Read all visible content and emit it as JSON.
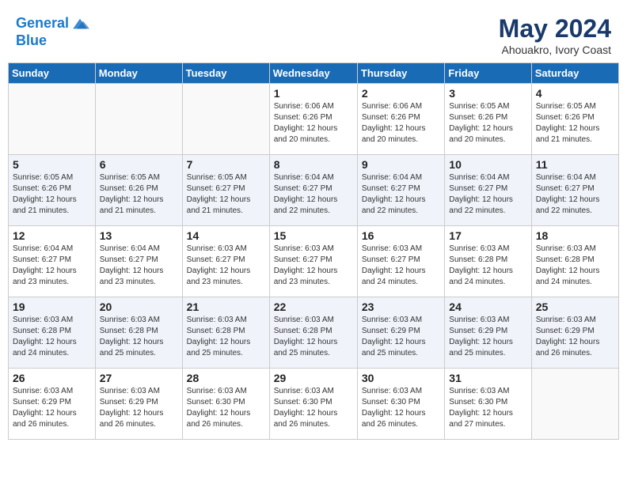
{
  "header": {
    "logo_line1": "General",
    "logo_line2": "Blue",
    "month_year": "May 2024",
    "location": "Ahouakro, Ivory Coast"
  },
  "weekdays": [
    "Sunday",
    "Monday",
    "Tuesday",
    "Wednesday",
    "Thursday",
    "Friday",
    "Saturday"
  ],
  "weeks": [
    [
      {
        "day": "",
        "info": ""
      },
      {
        "day": "",
        "info": ""
      },
      {
        "day": "",
        "info": ""
      },
      {
        "day": "1",
        "info": "Sunrise: 6:06 AM\nSunset: 6:26 PM\nDaylight: 12 hours\nand 20 minutes."
      },
      {
        "day": "2",
        "info": "Sunrise: 6:06 AM\nSunset: 6:26 PM\nDaylight: 12 hours\nand 20 minutes."
      },
      {
        "day": "3",
        "info": "Sunrise: 6:05 AM\nSunset: 6:26 PM\nDaylight: 12 hours\nand 20 minutes."
      },
      {
        "day": "4",
        "info": "Sunrise: 6:05 AM\nSunset: 6:26 PM\nDaylight: 12 hours\nand 21 minutes."
      }
    ],
    [
      {
        "day": "5",
        "info": "Sunrise: 6:05 AM\nSunset: 6:26 PM\nDaylight: 12 hours\nand 21 minutes."
      },
      {
        "day": "6",
        "info": "Sunrise: 6:05 AM\nSunset: 6:26 PM\nDaylight: 12 hours\nand 21 minutes."
      },
      {
        "day": "7",
        "info": "Sunrise: 6:05 AM\nSunset: 6:27 PM\nDaylight: 12 hours\nand 21 minutes."
      },
      {
        "day": "8",
        "info": "Sunrise: 6:04 AM\nSunset: 6:27 PM\nDaylight: 12 hours\nand 22 minutes."
      },
      {
        "day": "9",
        "info": "Sunrise: 6:04 AM\nSunset: 6:27 PM\nDaylight: 12 hours\nand 22 minutes."
      },
      {
        "day": "10",
        "info": "Sunrise: 6:04 AM\nSunset: 6:27 PM\nDaylight: 12 hours\nand 22 minutes."
      },
      {
        "day": "11",
        "info": "Sunrise: 6:04 AM\nSunset: 6:27 PM\nDaylight: 12 hours\nand 22 minutes."
      }
    ],
    [
      {
        "day": "12",
        "info": "Sunrise: 6:04 AM\nSunset: 6:27 PM\nDaylight: 12 hours\nand 23 minutes."
      },
      {
        "day": "13",
        "info": "Sunrise: 6:04 AM\nSunset: 6:27 PM\nDaylight: 12 hours\nand 23 minutes."
      },
      {
        "day": "14",
        "info": "Sunrise: 6:03 AM\nSunset: 6:27 PM\nDaylight: 12 hours\nand 23 minutes."
      },
      {
        "day": "15",
        "info": "Sunrise: 6:03 AM\nSunset: 6:27 PM\nDaylight: 12 hours\nand 23 minutes."
      },
      {
        "day": "16",
        "info": "Sunrise: 6:03 AM\nSunset: 6:27 PM\nDaylight: 12 hours\nand 24 minutes."
      },
      {
        "day": "17",
        "info": "Sunrise: 6:03 AM\nSunset: 6:28 PM\nDaylight: 12 hours\nand 24 minutes."
      },
      {
        "day": "18",
        "info": "Sunrise: 6:03 AM\nSunset: 6:28 PM\nDaylight: 12 hours\nand 24 minutes."
      }
    ],
    [
      {
        "day": "19",
        "info": "Sunrise: 6:03 AM\nSunset: 6:28 PM\nDaylight: 12 hours\nand 24 minutes."
      },
      {
        "day": "20",
        "info": "Sunrise: 6:03 AM\nSunset: 6:28 PM\nDaylight: 12 hours\nand 25 minutes."
      },
      {
        "day": "21",
        "info": "Sunrise: 6:03 AM\nSunset: 6:28 PM\nDaylight: 12 hours\nand 25 minutes."
      },
      {
        "day": "22",
        "info": "Sunrise: 6:03 AM\nSunset: 6:28 PM\nDaylight: 12 hours\nand 25 minutes."
      },
      {
        "day": "23",
        "info": "Sunrise: 6:03 AM\nSunset: 6:29 PM\nDaylight: 12 hours\nand 25 minutes."
      },
      {
        "day": "24",
        "info": "Sunrise: 6:03 AM\nSunset: 6:29 PM\nDaylight: 12 hours\nand 25 minutes."
      },
      {
        "day": "25",
        "info": "Sunrise: 6:03 AM\nSunset: 6:29 PM\nDaylight: 12 hours\nand 26 minutes."
      }
    ],
    [
      {
        "day": "26",
        "info": "Sunrise: 6:03 AM\nSunset: 6:29 PM\nDaylight: 12 hours\nand 26 minutes."
      },
      {
        "day": "27",
        "info": "Sunrise: 6:03 AM\nSunset: 6:29 PM\nDaylight: 12 hours\nand 26 minutes."
      },
      {
        "day": "28",
        "info": "Sunrise: 6:03 AM\nSunset: 6:30 PM\nDaylight: 12 hours\nand 26 minutes."
      },
      {
        "day": "29",
        "info": "Sunrise: 6:03 AM\nSunset: 6:30 PM\nDaylight: 12 hours\nand 26 minutes."
      },
      {
        "day": "30",
        "info": "Sunrise: 6:03 AM\nSunset: 6:30 PM\nDaylight: 12 hours\nand 26 minutes."
      },
      {
        "day": "31",
        "info": "Sunrise: 6:03 AM\nSunset: 6:30 PM\nDaylight: 12 hours\nand 27 minutes."
      },
      {
        "day": "",
        "info": ""
      }
    ]
  ]
}
